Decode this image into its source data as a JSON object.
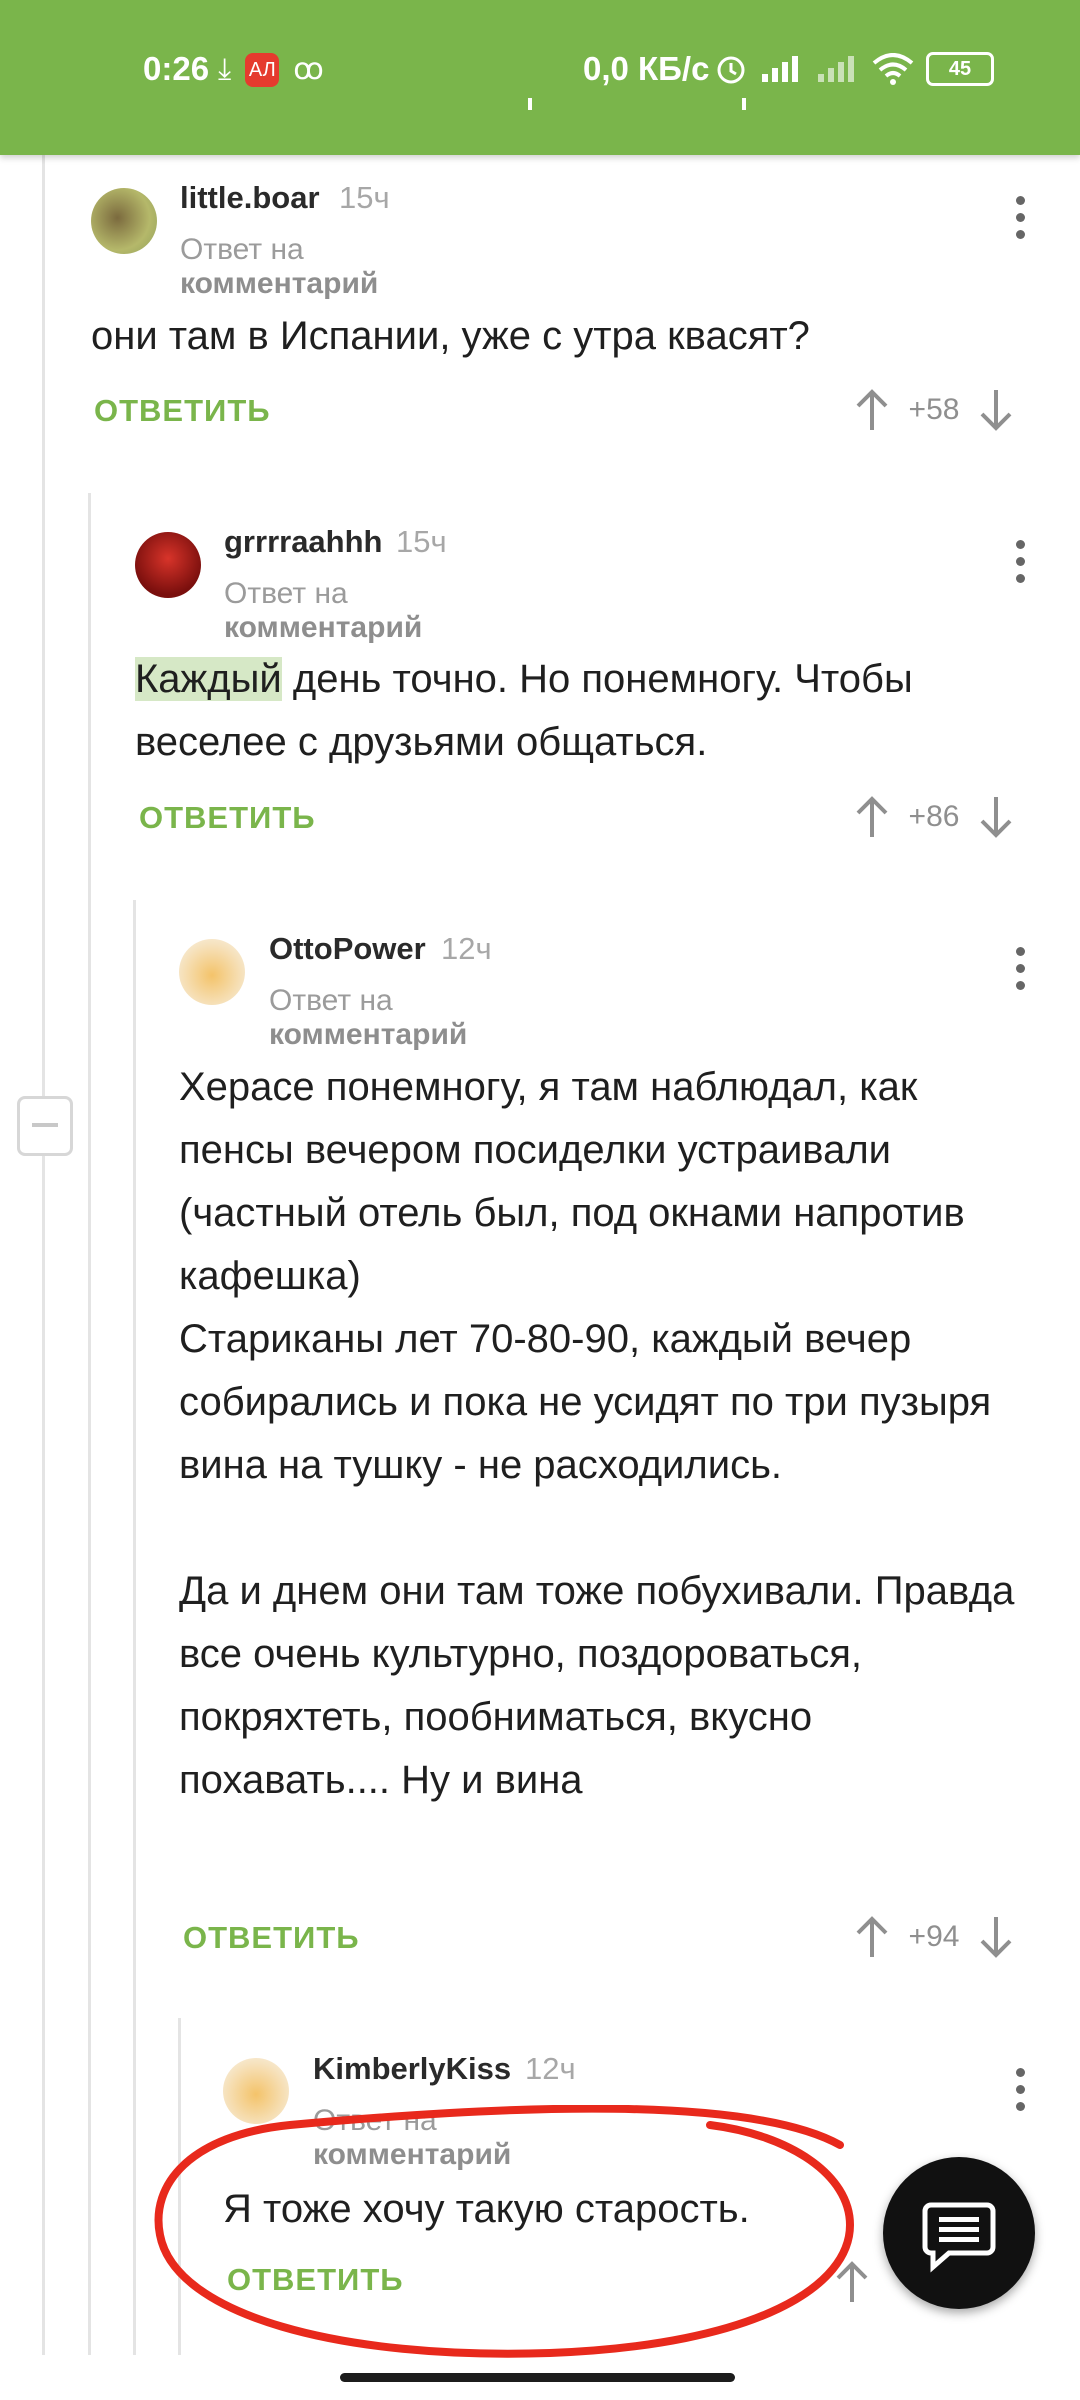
{
  "status_bar": {
    "time": "0:26",
    "network_speed": "0,0 КБ/с",
    "battery": "45",
    "app_badge": "АЛ",
    "left_icons": [
      "download-icon",
      "aliexpress-app-icon",
      "odnoklassniki-icon"
    ],
    "right_icons": [
      "alarm-icon",
      "signal-icon",
      "signal-icon",
      "wifi-icon",
      "battery-icon"
    ]
  },
  "comments": [
    {
      "username": "little.boar",
      "time": "15ч",
      "reply_prefix": "Ответ на",
      "reply_target": "комментарий",
      "text": "они там в Испании, уже с утра квасят?",
      "reply_label": "ОТВЕТИТЬ",
      "score": "+58"
    },
    {
      "username": "grrrraahhh",
      "time": "15ч",
      "reply_prefix": "Ответ на",
      "reply_target": "комментарий",
      "highlighted_word": "Каждый",
      "text_rest": " день точно. Но понемногу. Чтобы веселее с друзьями общаться.",
      "reply_label": "ОТВЕТИТЬ",
      "score": "+86"
    },
    {
      "username": "OttoPower",
      "time": "12ч",
      "reply_prefix": "Ответ на",
      "reply_target": "комментарий",
      "text": "Херасе понемногу, я там наблюдал, как пенсы вечером посиделки устраивали (частный отель был, под окнами напротив кафешка)\nСтариканы лет 70-80-90, каждый вечер собирались и пока не усидят по три пузыря вина на тушку - не расходились.\n\nДа и днем они там тоже побухивали. Правда все очень культурно, поздороваться, покряхтеть, пообниматься, вкусно похавать.... Ну и вина",
      "reply_label": "ОТВЕТИТЬ",
      "score": "+94"
    },
    {
      "username": "KimberlyKiss",
      "time": "12ч",
      "reply_prefix": "Ответ на",
      "reply_target": "комментарий",
      "text": "Я тоже хочу такую старость.",
      "reply_label": "ОТВЕТИТЬ",
      "score": ""
    }
  ],
  "fab": {
    "icon": "chat-icon"
  },
  "colors": {
    "accent": "#7ab54b",
    "annotation": "#e8291c"
  }
}
